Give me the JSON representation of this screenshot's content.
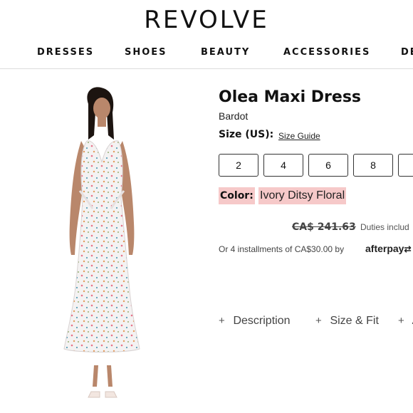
{
  "header": {
    "logo": "REVOLVE",
    "nav": [
      "DRESSES",
      "SHOES",
      "BEAUTY",
      "ACCESSORIES",
      "DE"
    ]
  },
  "product": {
    "title": "Olea Maxi Dress",
    "brand": "Bardot",
    "size_label": "Size (US):",
    "size_guide": "Size Guide",
    "sizes": [
      "2",
      "4",
      "6",
      "8",
      ""
    ],
    "color_label": "Color:",
    "color_value": "Ivory Ditsy Floral",
    "price": "CA$ 241.63",
    "duties": "Duties includ",
    "installments": "Or 4 installments of CA$30.00 by",
    "afterpay": "afterpay",
    "tabs": [
      "Description",
      "Size & Fit",
      "A"
    ]
  },
  "colors": {
    "highlight": "#f6c9c9",
    "text": "#111111",
    "border": "#333333"
  }
}
